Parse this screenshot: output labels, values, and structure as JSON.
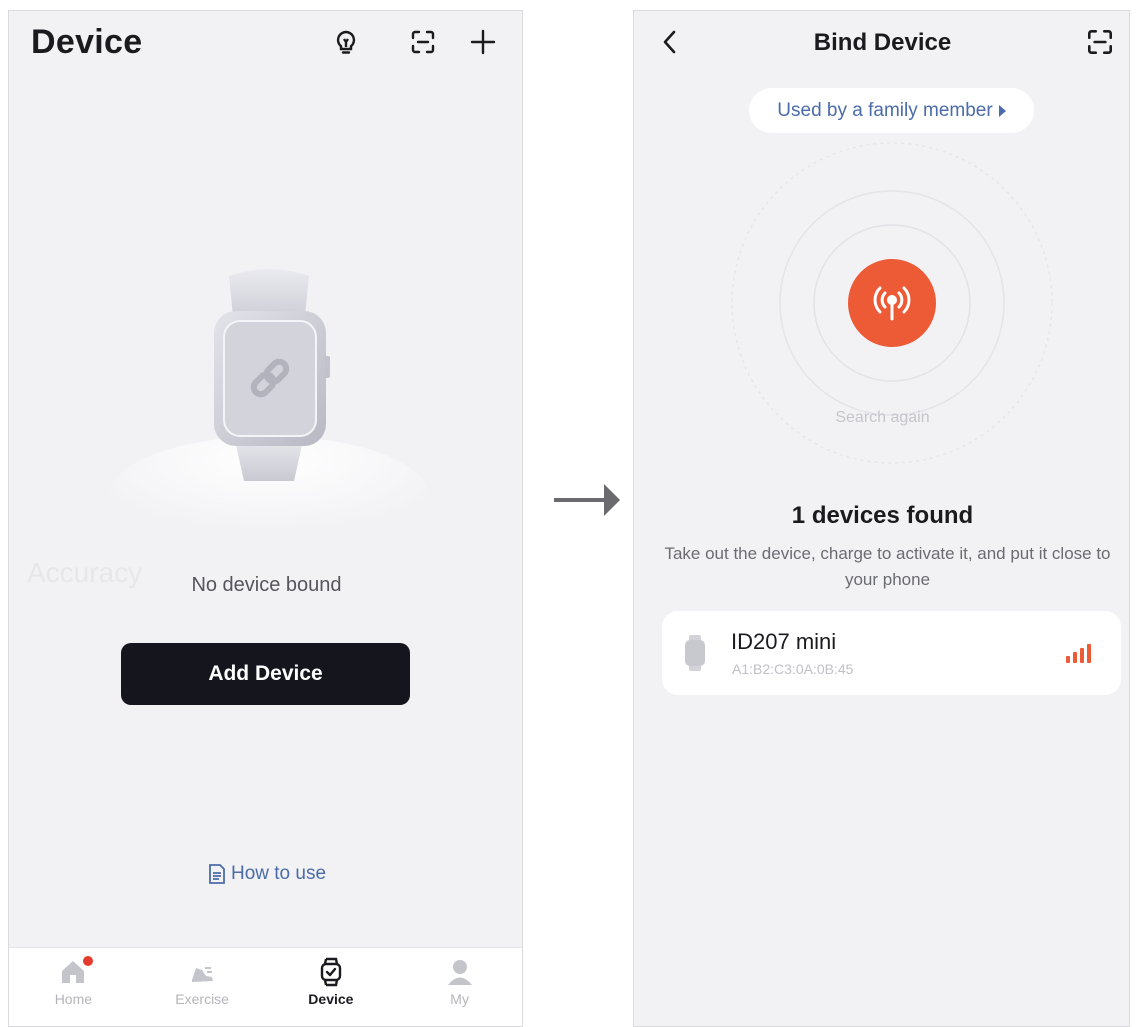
{
  "left": {
    "title": "Device",
    "watermark": "Accuracy",
    "empty_text": "No device bound",
    "add_button": "Add Device",
    "how_to": "How to use",
    "tabs": [
      {
        "label": "Home",
        "icon": "home-icon",
        "badge": true
      },
      {
        "label": "Exercise",
        "icon": "running-shoe-icon"
      },
      {
        "label": "Device",
        "icon": "watch-icon",
        "active": true
      },
      {
        "label": "My",
        "icon": "person-icon"
      }
    ],
    "top_icons": [
      "lightbulb-icon",
      "scan-icon",
      "plus-icon"
    ]
  },
  "right": {
    "title": "Bind Device",
    "family_link": "Used by a family member",
    "search_again": "Search again",
    "found": "1 devices found",
    "hint": "Take out the device, charge to activate it, and put it close to your phone",
    "device": {
      "name": "ID207 mini",
      "mac": "A1:B2:C3:0A:0B:45",
      "signal_bars": 4
    }
  },
  "colors": {
    "accent": "#ec5a36",
    "link": "#4b6ca8",
    "dark_button": "#15151d",
    "badge": "#e53b2e"
  }
}
